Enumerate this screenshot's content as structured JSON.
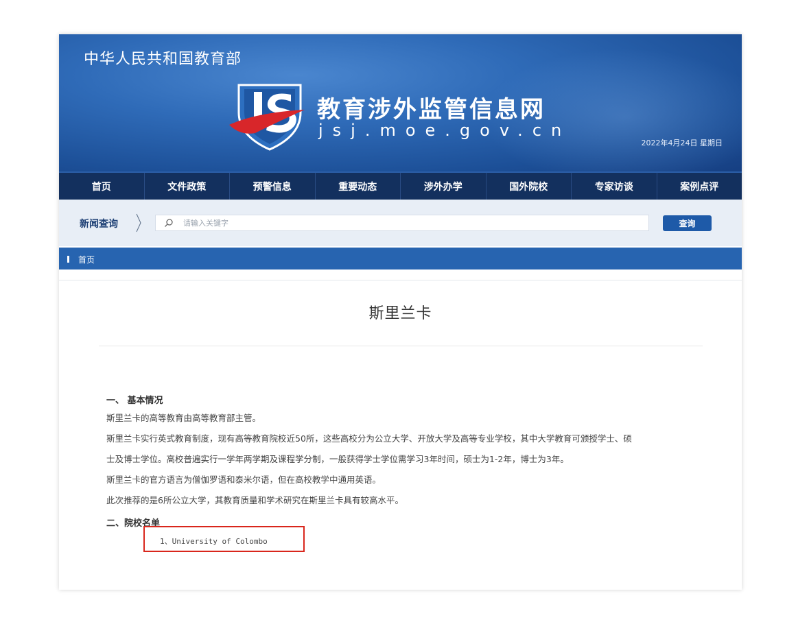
{
  "header": {
    "ministry": "中华人民共和国教育部",
    "site_title": "教育涉外监管信息网",
    "site_domain": "jsj.moe.gov.cn",
    "date": "2022年4月24日 星期日",
    "logo_icon": "js-shield-logo-icon"
  },
  "nav": {
    "items": [
      "首页",
      "文件政策",
      "预警信息",
      "重要动态",
      "涉外办学",
      "国外院校",
      "专家访谈",
      "案例点评"
    ]
  },
  "search": {
    "label": "新闻查询",
    "placeholder": "请输入关键字",
    "button": "查询"
  },
  "breadcrumb": {
    "home": "首页"
  },
  "article": {
    "title": "斯里兰卡",
    "section1_heading": "一、  基本情况",
    "paragraphs": [
      "斯里兰卡的高等教育由高等教育部主管。",
      "斯里兰卡实行英式教育制度，现有高等教育院校近50所，这些高校分为公立大学、开放大学及高等专业学校，其中大学教育可颁授学士、硕",
      "士及博士学位。高校普遍实行一学年两学期及课程学分制，一般获得学士学位需学习3年时间，硕士为1-2年，博士为3年。",
      "斯里兰卡的官方语言为僧伽罗语和泰米尔语，但在高校教学中通用英语。",
      "此次推荐的是6所公立大学，其教育质量和学术研究在斯里兰卡具有较高水平。"
    ],
    "section2_heading": "二、院校名单",
    "schools": [
      "1、University of Colombo"
    ]
  },
  "colors": {
    "banner_blue": "#2f6bb8",
    "nav_navy": "#13305e",
    "breadcrumb_blue": "#2764b0",
    "highlight_red": "#d9261c"
  }
}
